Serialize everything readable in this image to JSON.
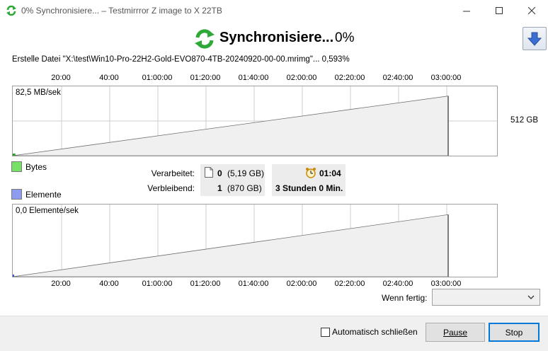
{
  "window": {
    "title": "0% Synchronisiere... – Testmirrror Z image to X 22TB"
  },
  "header": {
    "title": "Synchronisiere...",
    "percent": "0%",
    "icon": "sync-arrows-icon",
    "collapse_icon": "arrow-down-icon"
  },
  "current_file": "Erstelle Datei \"X:\\test\\Win10-Pro-22H2-Gold-EVO870-4TB-20240920-00-00.mrimg\"... 0,593%",
  "time_axis": [
    "20:00",
    "40:00",
    "01:00:00",
    "01:20:00",
    "01:40:00",
    "02:00:00",
    "02:20:00",
    "02:40:00",
    "03:00:00"
  ],
  "bytes_chart": {
    "speed": "82,5 MB/sek",
    "total_label": "512 GB",
    "legend": "Bytes",
    "legend_color": "#77e066",
    "progress_fraction": 0.0059
  },
  "items_chart": {
    "speed": "0,0 Elemente/sek",
    "legend": "Elemente",
    "legend_color": "#8d9cf0",
    "progress_fraction": 0.0
  },
  "stats": {
    "processed_label": "Verarbeitet:",
    "remaining_label": "Verbleibend:",
    "processed_count": "0",
    "processed_size": "(5,19 GB)",
    "remaining_count": "1",
    "remaining_size": "(870 GB)",
    "elapsed": "01:04",
    "remaining_time": "3 Stunden 0 Min.",
    "file_icon": "file-icon",
    "clock_icon": "alarm-clock-icon"
  },
  "when_done": {
    "label": "Wenn fertig:",
    "value": ""
  },
  "footer": {
    "auto_close_label": "Automatisch schließen",
    "auto_close_checked": false,
    "pause_label": "Pause",
    "stop_label": "Stop"
  }
}
